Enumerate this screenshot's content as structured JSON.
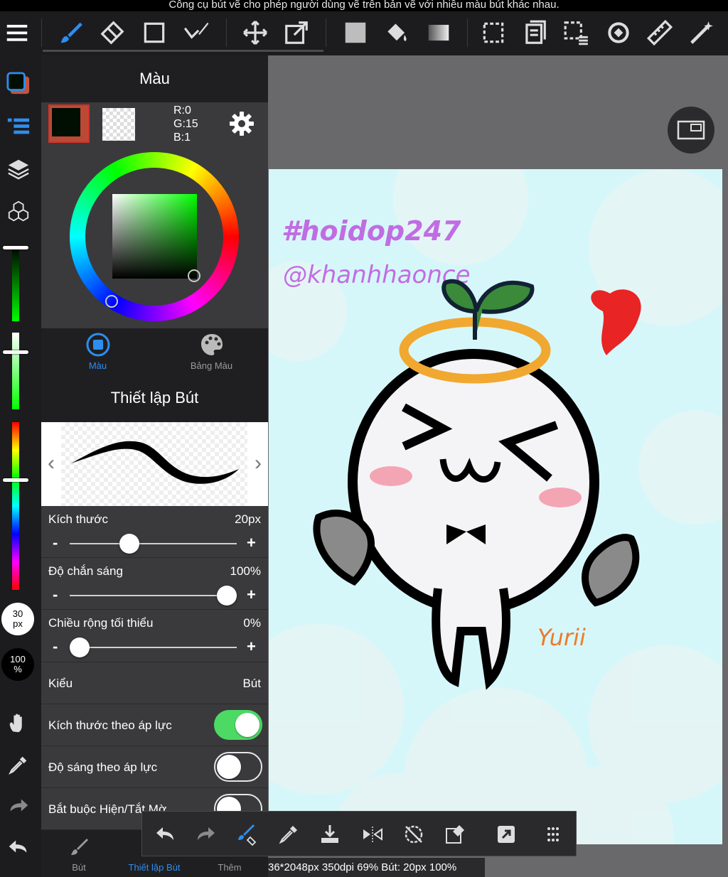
{
  "caption": "Công cụ bút vẽ cho phép người dùng vẽ trên bản vẽ với nhiều màu bút khác nhau.",
  "toolbar": {
    "items": [
      "menu-icon",
      "brush-icon",
      "eraser-icon",
      "rectangle-icon",
      "vector-pen-icon",
      "move-icon",
      "transform-icon",
      "fill-color-icon",
      "bucket-icon",
      "gradient-icon",
      "select-icon",
      "copy-icon",
      "select-pen-icon",
      "rotate-icon",
      "ruler-icon",
      "magic-wand-icon"
    ]
  },
  "left_bar": {
    "brush_size": {
      "value": "30",
      "unit": "px"
    },
    "opacity": {
      "value": "100",
      "unit": "%"
    },
    "brightness_level": 0.0,
    "saturation_level": 0.24,
    "hue_level": 0.34
  },
  "color_panel": {
    "title": "Màu",
    "current_color": "#000f01",
    "rgb": {
      "r": "R:0",
      "g": "G:15",
      "b": "B:1"
    },
    "tabs": [
      {
        "label": "Màu",
        "active": true
      },
      {
        "label": "Bảng Màu",
        "active": false
      }
    ]
  },
  "brush_panel": {
    "title": "Thiết lập Bút",
    "settings": [
      {
        "label": "Kích thước",
        "value": "20px",
        "level": 0.34
      },
      {
        "label": "Độ chắn sáng",
        "value": "100%",
        "level": 1.0
      },
      {
        "label": "Chiều rộng tối thiểu",
        "value": "0%",
        "level": 0.0
      }
    ],
    "type_row": {
      "label": "Kiểu",
      "value": "Bút"
    },
    "toggles": [
      {
        "label": "Kích thước theo áp lực",
        "on": true
      },
      {
        "label": "Độ sáng theo áp lực",
        "on": false
      },
      {
        "label": "Bắt buộc Hiện/Tắt Mờ",
        "on": false
      }
    ],
    "bottom_tabs": [
      {
        "label": "Bút",
        "active": false
      },
      {
        "label": "Thiết lập Bút",
        "active": true
      },
      {
        "label": "Thêm",
        "active": false
      }
    ]
  },
  "canvas": {
    "artwork_text": {
      "line1": "#hoidop247",
      "line2": "@khanhhaonce",
      "signature": "Yurii"
    },
    "status": "36*2048px 350dpi 69% Bút: 20px 100%"
  },
  "colors": {
    "accent": "#2d8ef0",
    "toggle_on": "#4cd964",
    "canvas_bg": "#d6f7fa"
  }
}
